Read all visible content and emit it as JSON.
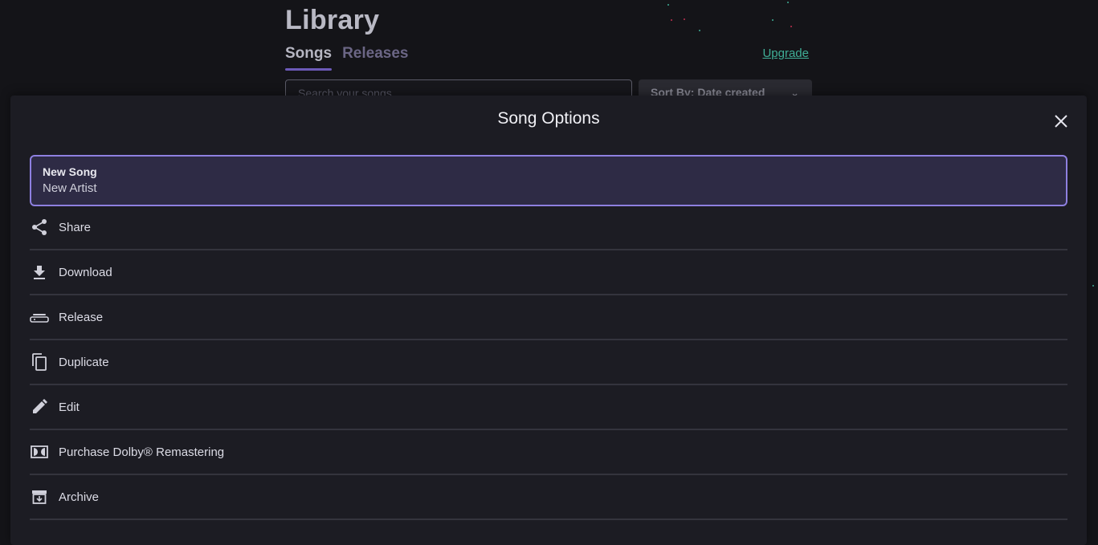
{
  "library": {
    "title": "Library",
    "tabs": [
      {
        "label": "Songs",
        "active": true
      },
      {
        "label": "Releases",
        "active": false
      }
    ],
    "upgrade_label": "Upgrade",
    "search_placeholder": "Search your songs",
    "sort_label": "Sort By: Date created"
  },
  "modal": {
    "title": "Song Options",
    "song": {
      "title": "New Song",
      "artist": "New Artist"
    },
    "options": [
      {
        "label": "Share",
        "icon": "share-icon"
      },
      {
        "label": "Download",
        "icon": "download-icon"
      },
      {
        "label": "Release",
        "icon": "release-icon"
      },
      {
        "label": "Duplicate",
        "icon": "duplicate-icon"
      },
      {
        "label": "Edit",
        "icon": "edit-icon"
      },
      {
        "label": "Purchase Dolby® Remastering",
        "icon": "dolby-icon"
      },
      {
        "label": "Archive",
        "icon": "archive-icon"
      }
    ]
  },
  "colors": {
    "accent": "#8e80e0",
    "tab_underline": "#6c5ab8",
    "upgrade": "#3fae96",
    "modal_bg": "#1c1c23",
    "page_bg": "#141418"
  }
}
